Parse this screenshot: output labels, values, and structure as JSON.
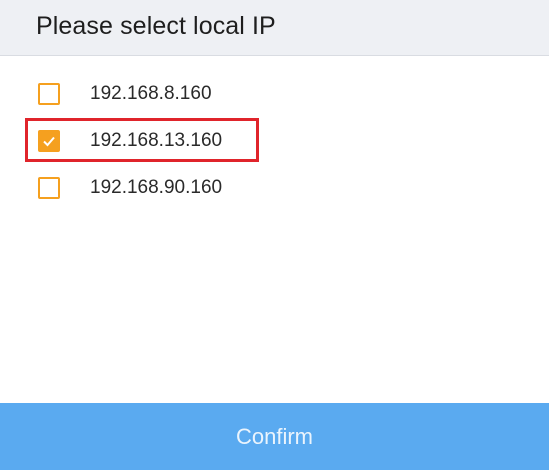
{
  "dialog": {
    "title": "Please select local IP",
    "ip_options": [
      {
        "label": "192.168.8.160",
        "checked": false
      },
      {
        "label": "192.168.13.160",
        "checked": true
      },
      {
        "label": "192.168.90.160",
        "checked": false
      }
    ],
    "confirm_label": "Confirm"
  },
  "colors": {
    "checkbox_accent": "#f5a01f",
    "highlight_border": "#e0242b",
    "confirm_background": "#5aaaf0",
    "header_background": "#eef0f4"
  },
  "icons": {
    "checked_mark": "checkmark-icon"
  }
}
